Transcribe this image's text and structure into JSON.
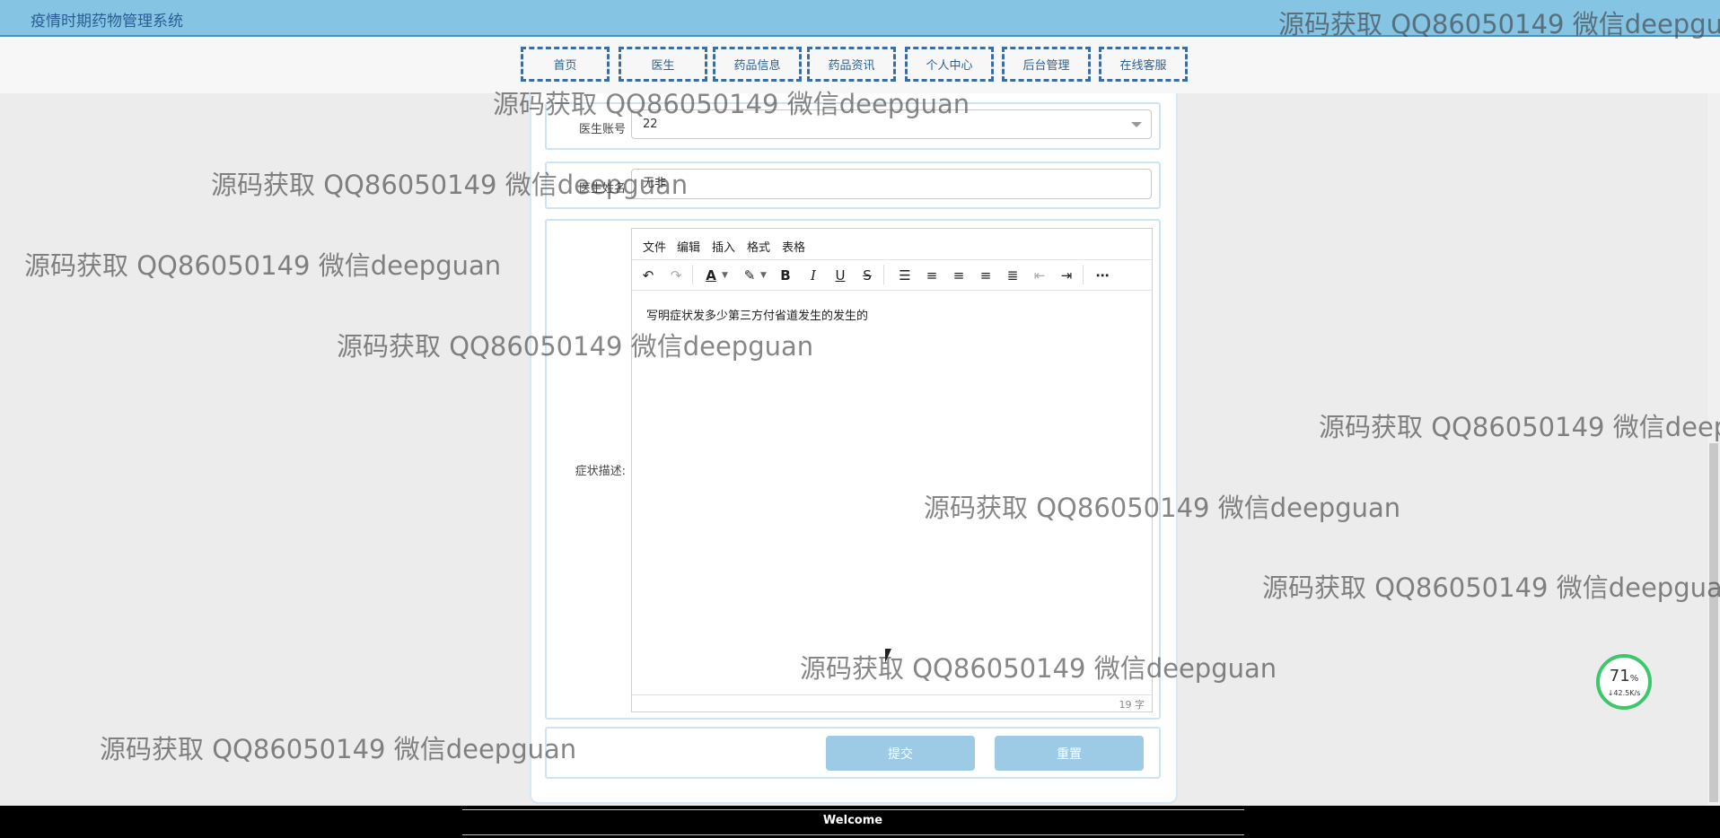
{
  "header": {
    "app_title": "疫情时期药物管理系统"
  },
  "nav": {
    "items": [
      {
        "label": "首页"
      },
      {
        "label": "医生"
      },
      {
        "label": "药品信息"
      },
      {
        "label": "药品资讯"
      },
      {
        "label": "个人中心"
      },
      {
        "label": "后台管理"
      },
      {
        "label": "在线客服"
      }
    ]
  },
  "form": {
    "doctor_account": {
      "label": "医生账号",
      "value": "22"
    },
    "doctor_name": {
      "label": "医生姓名",
      "value": "无非"
    },
    "symptom": {
      "label": "症状描述:",
      "menu": [
        "文件",
        "编辑",
        "插入",
        "格式",
        "表格"
      ],
      "content": "写明症状发多少第三方付省道发生的发生的",
      "word_count": "19 字"
    },
    "submit_label": "提交",
    "reset_label": "重置"
  },
  "footer": {
    "text": "Welcome"
  },
  "net_widget": {
    "percent": "71",
    "unit": "%",
    "speed": "↓42.5K/s"
  },
  "watermark": {
    "text": "源码获取 QQ86050149 微信deepguan"
  },
  "colors": {
    "header_bg": "#86c4e4",
    "nav_border": "#3b6ea0",
    "button_bg": "#9dcbe6",
    "footer_bg": "#000000",
    "progress_ring": "#3cc76a"
  },
  "icons": {
    "toolbar": [
      "undo-icon",
      "redo-icon",
      "font-color-icon",
      "highlight-icon",
      "bold-icon",
      "italic-icon",
      "underline-icon",
      "strikethrough-icon",
      "bullet-list-icon",
      "align-left-icon",
      "align-center-icon",
      "align-right-icon",
      "align-justify-icon",
      "outdent-icon",
      "indent-icon",
      "more-icon"
    ]
  }
}
